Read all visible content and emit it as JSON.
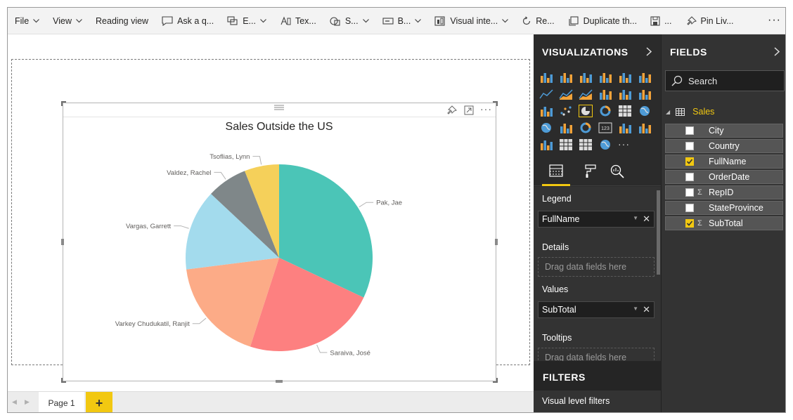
{
  "toolbar": {
    "items": [
      {
        "label": "File"
      },
      {
        "label": "View"
      },
      {
        "label": "Reading view"
      },
      {
        "label": "Ask a q..."
      },
      {
        "label": "E..."
      },
      {
        "label": "Tex..."
      },
      {
        "label": "S..."
      },
      {
        "label": "B..."
      },
      {
        "label": "Visual inte..."
      },
      {
        "label": "Re..."
      },
      {
        "label": "Duplicate th..."
      },
      {
        "label": "..."
      },
      {
        "label": "Pin Liv..."
      }
    ],
    "more": "···"
  },
  "visual": {
    "title": "Sales Outside the US"
  },
  "chart_data": {
    "type": "pie",
    "title": "Sales Outside the US",
    "slices": [
      {
        "label": "Pak, Jae",
        "value": 32,
        "color": "#4bc5b7"
      },
      {
        "label": "Saraiva, José",
        "value": 23,
        "color": "#fd8080"
      },
      {
        "label": "Varkey Chudukatil, Ranjit",
        "value": 18,
        "color": "#fcab87"
      },
      {
        "label": "Vargas, Garrett",
        "value": 14,
        "color": "#a3dbed"
      },
      {
        "label": "Valdez, Rachel",
        "value": 7,
        "color": "#7f8789"
      },
      {
        "label": "Tsoflias, Lynn",
        "value": 6,
        "color": "#f5d05a"
      }
    ],
    "legend": "none"
  },
  "page_tabs": {
    "pages": [
      "Page 1"
    ],
    "add": "+"
  },
  "visualizations": {
    "title": "VISUALIZATIONS",
    "wells": {
      "legend_label": "Legend",
      "legend_field": "FullName",
      "details_label": "Details",
      "details_placeholder": "Drag data fields here",
      "values_label": "Values",
      "values_field": "SubTotal",
      "tooltips_label": "Tooltips",
      "tooltips_placeholder": "Drag data fields here"
    }
  },
  "filters": {
    "title": "FILTERS",
    "visual_level": "Visual level filters"
  },
  "fields": {
    "title": "FIELDS",
    "search_placeholder": "Search",
    "table_name": "Sales",
    "items": [
      {
        "name": "City",
        "checked": false,
        "sigma": false
      },
      {
        "name": "Country",
        "checked": false,
        "sigma": false
      },
      {
        "name": "FullName",
        "checked": true,
        "sigma": false
      },
      {
        "name": "OrderDate",
        "checked": false,
        "sigma": false
      },
      {
        "name": "RepID",
        "checked": false,
        "sigma": true
      },
      {
        "name": "StateProvince",
        "checked": false,
        "sigma": false
      },
      {
        "name": "SubTotal",
        "checked": true,
        "sigma": true
      }
    ]
  },
  "colors": {
    "accent": "#f2c811",
    "pane_dark": "#2b2b2b"
  }
}
